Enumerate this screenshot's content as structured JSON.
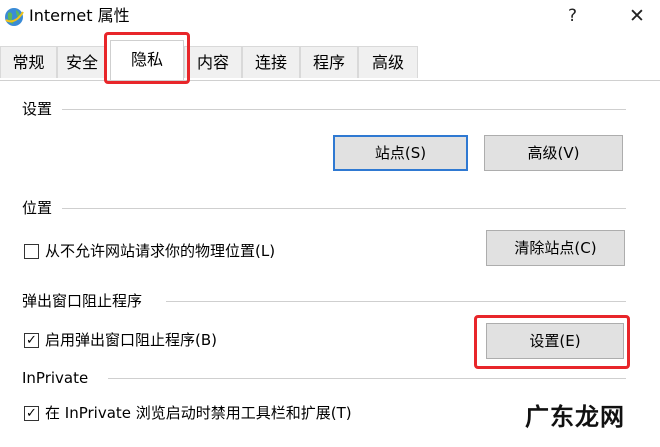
{
  "window": {
    "title": "Internet 属性",
    "help_glyph": "?",
    "close_glyph": "✕"
  },
  "tabs": [
    {
      "label": "常规"
    },
    {
      "label": "安全"
    },
    {
      "label": "隐私",
      "active": true
    },
    {
      "label": "内容"
    },
    {
      "label": "连接"
    },
    {
      "label": "程序"
    },
    {
      "label": "高级"
    }
  ],
  "sections": {
    "settings": {
      "label": "设置",
      "sites_button": "站点(S)",
      "advanced_button": "高级(V)"
    },
    "location": {
      "label": "位置",
      "checkbox_label": "从不允许网站请求你的物理位置(L)",
      "checked": false,
      "clear_sites_button": "清除站点(C)"
    },
    "popup_blocker": {
      "label": "弹出窗口阻止程序",
      "checkbox_label": "启用弹出窗口阻止程序(B)",
      "checked": true,
      "settings_button": "设置(E)"
    },
    "inprivate": {
      "label": "InPrivate",
      "checkbox_label": "在 InPrivate 浏览启动时禁用工具栏和扩展(T)",
      "checked": true
    }
  },
  "check_glyph": "✓",
  "watermark": "广东龙网",
  "colors": {
    "highlight": "#e8262a",
    "default_button_border": "#2f79d2",
    "button_face": "#e1e1e1"
  }
}
